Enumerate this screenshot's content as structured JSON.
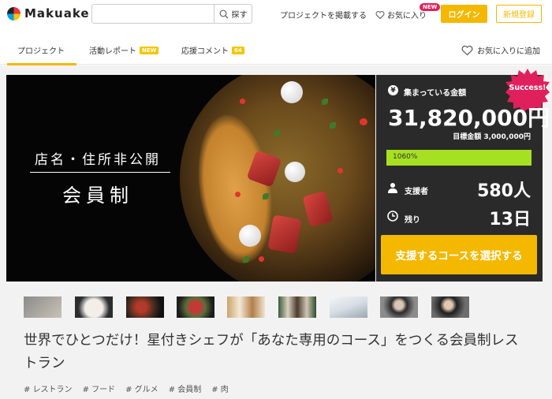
{
  "header": {
    "logo_text": "Makuake",
    "search_placeholder": "",
    "search_button": "探す",
    "post_project": "プロジェクトを掲載する",
    "favorites": "お気に入り",
    "favorites_badge": "NEW",
    "login": "ログイン",
    "signup": "新規登録"
  },
  "tabs": [
    {
      "label": "プロジェクト",
      "badge": "",
      "active": true
    },
    {
      "label": "活動レポート",
      "badge": "NEW",
      "active": false
    },
    {
      "label": "応援コメント",
      "badge": "64",
      "active": false
    }
  ],
  "favorite_add": "お気に入りに追加",
  "hero": {
    "caption_line1": "店名・住所非公開",
    "caption_line2": "会員制"
  },
  "stats": {
    "success_badge": "Success!",
    "raised_label": "集まっている金額",
    "raised_amount": "31,820,000円",
    "goal_text": "目標金額 3,000,000円",
    "progress_label": "1060%",
    "progress_fraction": 1.0,
    "supporters_label": "支援者",
    "supporters_value": "580人",
    "remaining_label": "残り",
    "remaining_value": "13日",
    "cta": "支援するコースを選択する",
    "colors": {
      "accent": "#f4b800",
      "progress": "#a6e022",
      "panel": "#2a2a2a",
      "badge": "#e0205c"
    }
  },
  "thumbnails": [
    {
      "name": "thumb-1"
    },
    {
      "name": "thumb-2"
    },
    {
      "name": "thumb-3"
    },
    {
      "name": "thumb-4"
    },
    {
      "name": "thumb-5"
    },
    {
      "name": "thumb-6"
    },
    {
      "name": "thumb-7"
    },
    {
      "name": "thumb-8"
    },
    {
      "name": "thumb-9"
    }
  ],
  "project_title": "世界でひとつだけ！星付きシェフが「あなた専用のコース」をつくる会員制レストラン",
  "tags": [
    "# レストラン",
    "# フード",
    "# グルメ",
    "# 会員制",
    "# 肉"
  ]
}
